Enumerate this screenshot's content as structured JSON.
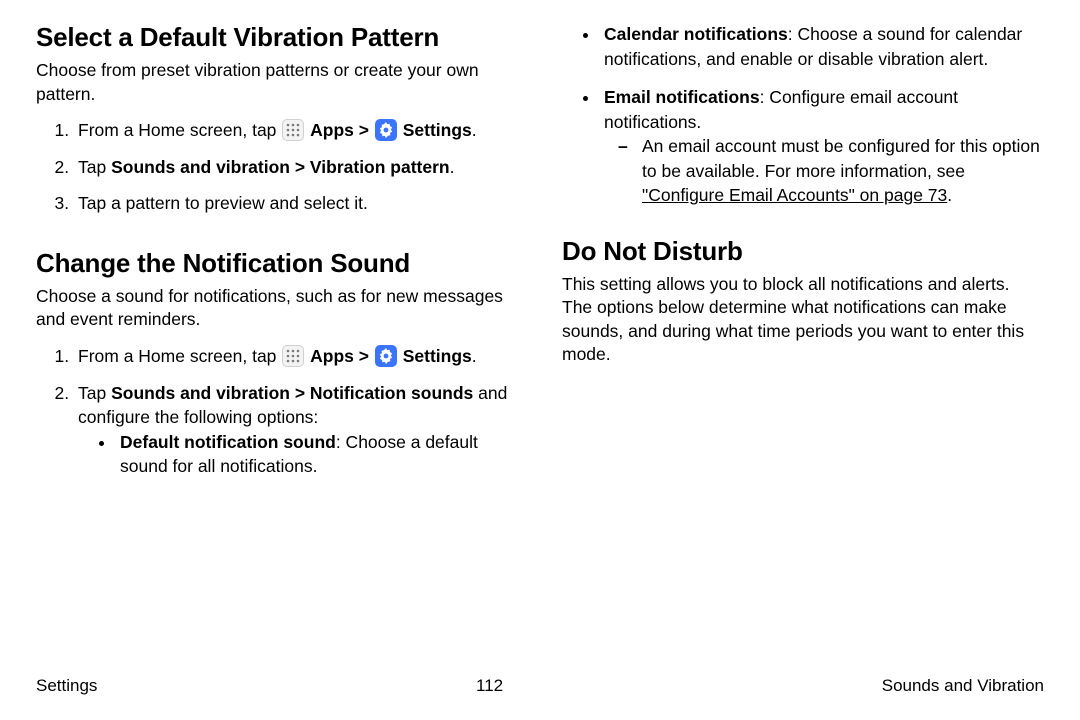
{
  "left": {
    "section1": {
      "title": "Select a Default Vibration Pattern",
      "intro": "Choose from preset vibration patterns or create your own pattern.",
      "step1_pre": "From a Home screen, tap ",
      "apps": "Apps",
      "chev": " > ",
      "settings": "Settings",
      "period": ".",
      "step2_pre": "Tap ",
      "step2_bold": "Sounds and vibration > Vibration pattern",
      "step2_post": ".",
      "step3": "Tap a pattern to preview and select it."
    },
    "section2": {
      "title": "Change the Notification Sound",
      "intro": "Choose a sound for notifications, such as for new messages and event reminders.",
      "step1_pre": "From a Home screen, tap ",
      "apps": "Apps",
      "chev": " > ",
      "settings": "Settings",
      "period": ".",
      "step2_pre": "Tap ",
      "step2_bold": "Sounds and vibration > Notification sounds",
      "step2_post": " and configure the following options:",
      "bullet1_bold": "Default notification sound",
      "bullet1_rest": ": Choose a default sound for all notifications."
    }
  },
  "right": {
    "bullets": {
      "cal_bold": "Calendar notifications",
      "cal_rest": ": Choose a sound for calendar notifications, and enable or disable vibration alert.",
      "email_bold": "Email notifications",
      "email_rest": ": Configure email account notifications.",
      "dash_pre": "An email account must be configured for this option to be available. For more information, see ",
      "dash_link": "\"Configure Email Accounts\" on page 73",
      "dash_post": "."
    },
    "section3": {
      "title": "Do Not Disturb",
      "intro": "This setting allows you to block all notifications and alerts. The options below determine what notifications can make sounds, and during what time periods you want to enter this mode."
    }
  },
  "footer": {
    "left": "Settings",
    "center": "112",
    "right": "Sounds and Vibration"
  }
}
